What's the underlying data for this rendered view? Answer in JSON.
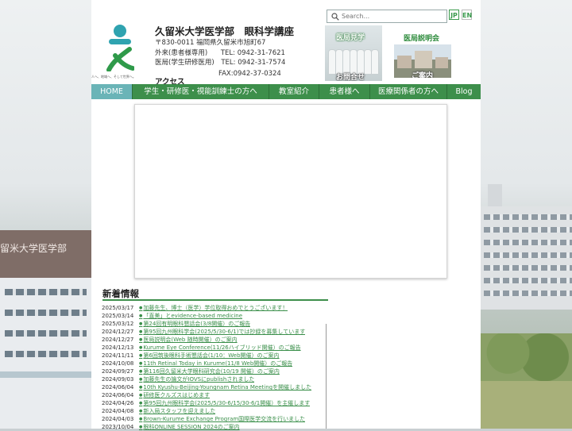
{
  "header": {
    "logo_tagline": "人へ、地域へ、そして世界へ。",
    "dept_title": "久留米大学医学部　眼科学講座",
    "postal_address": "〒830-0011 福岡県久留米市旭町67",
    "outpatient_label": "外来(患者様専用)",
    "outpatient_tel": "TEL: 0942-31-7621",
    "office_label": "医局(学生研修医用)",
    "office_tel": "TEL: 0942-31-7574",
    "fax": "FAX:0942-37-0324",
    "access": "アクセス"
  },
  "search": {
    "placeholder": "Search..."
  },
  "language": {
    "jp": "JP",
    "en": "EN"
  },
  "banners": {
    "recruit_top": "医局見学",
    "recruit_bottom": "お問合せ",
    "briefing_title": "医局説明会",
    "briefing_caption": "ご案内"
  },
  "nav": {
    "items": [
      "HOME",
      "学生・研修医・視能訓練士の方へ",
      "教室紹介",
      "患者様へ",
      "医療関係者の方へ",
      "Blog"
    ],
    "active_index": 0,
    "accent": "#3d8f4b",
    "active_color": "#6ab4b7"
  },
  "news": {
    "heading": "新着情報",
    "items": [
      {
        "date": "2025/03/17",
        "title": "加藤先生、博士（医学）学位取得おめでとうございます！"
      },
      {
        "date": "2025/03/14",
        "title": "「直美」とevidence-based medicine"
      },
      {
        "date": "2025/03/12",
        "title": "第24回有明眼科懇話会(3/8開催）のご報告"
      },
      {
        "date": "2024/12/27",
        "title": "第95回九州眼科学会(2025/5/30-6/1)では抄録を募集しています"
      },
      {
        "date": "2024/12/27",
        "title": "医局説明会(Web 随時開催）のご案内"
      },
      {
        "date": "2024/12/13",
        "title": "Kurume Eye Conference(11/26ハイブリッド開催）のご報告"
      },
      {
        "date": "2024/11/11",
        "title": "第6回筑後眼科手術懇話会(1/10：Web開催）のご案内"
      },
      {
        "date": "2024/10/08",
        "title": "11th Retinal Today in Kurume(11/8 Web開催）のご報告"
      },
      {
        "date": "2024/09/27",
        "title": "第116回久留米大学眼科研究会(10/19 開催）のご案内"
      },
      {
        "date": "2024/09/03",
        "title": "加藤先生の論文がIOVSにpublishされました"
      },
      {
        "date": "2024/06/04",
        "title": "10th Kyushu-Beijing-Youngnam Retina Meetingを開催しました"
      },
      {
        "date": "2024/06/04",
        "title": "研修医クルズスはじめます"
      },
      {
        "date": "2024/04/26",
        "title": "第95回九州眼科学会(2025/5/30-6/15/30-6/1開催）を主催します"
      },
      {
        "date": "2024/04/08",
        "title": "新入局スタッフを迎えました"
      },
      {
        "date": "2024/04/03",
        "title": "Brown-Kurume Exchange Program国際医学交流を行いました"
      },
      {
        "date": "2023/10/04",
        "title": "眼科ONLINE SESSION 2024のご案内"
      }
    ]
  },
  "colors": {
    "link": "#3a8f4a",
    "accent_green": "#3d8f4b",
    "logo_teal": "#2fa3b0",
    "logo_green": "#2f9a4a"
  }
}
